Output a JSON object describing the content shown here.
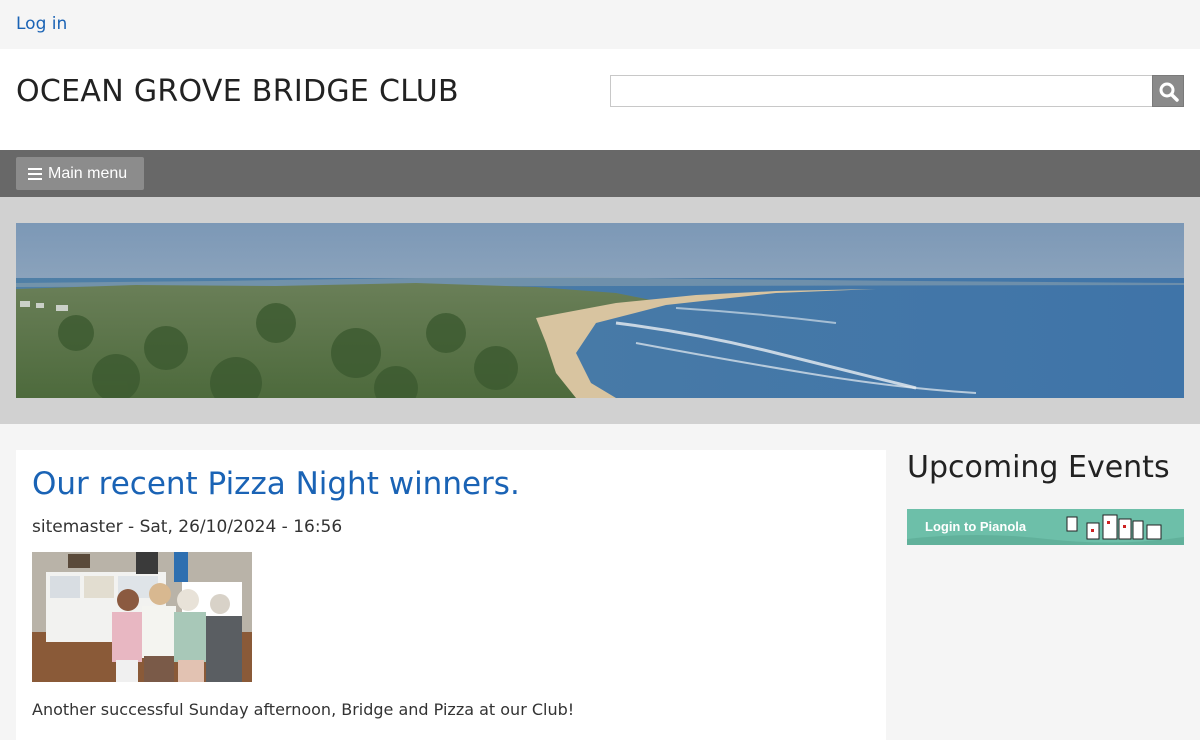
{
  "topbar": {
    "login_label": "Log in"
  },
  "header": {
    "site_title": "OCEAN GROVE BRIDGE CLUB",
    "search_value": ""
  },
  "nav": {
    "menu_label": "Main menu"
  },
  "article": {
    "title": "Our recent Pizza Night winners.",
    "byline": "sitemaster - Sat, 26/10/2024 - 16:56",
    "body": "Another successful Sunday afternoon, Bridge and Pizza at our Club!"
  },
  "sidebar": {
    "title": "Upcoming Events",
    "pianola_label": "Login to Pianola"
  },
  "colors": {
    "link": "#1a63b5",
    "navbar": "#686868",
    "pianola": "#6dbfa9"
  },
  "icons": {
    "search": "search-icon",
    "menu": "hamburger-icon"
  }
}
